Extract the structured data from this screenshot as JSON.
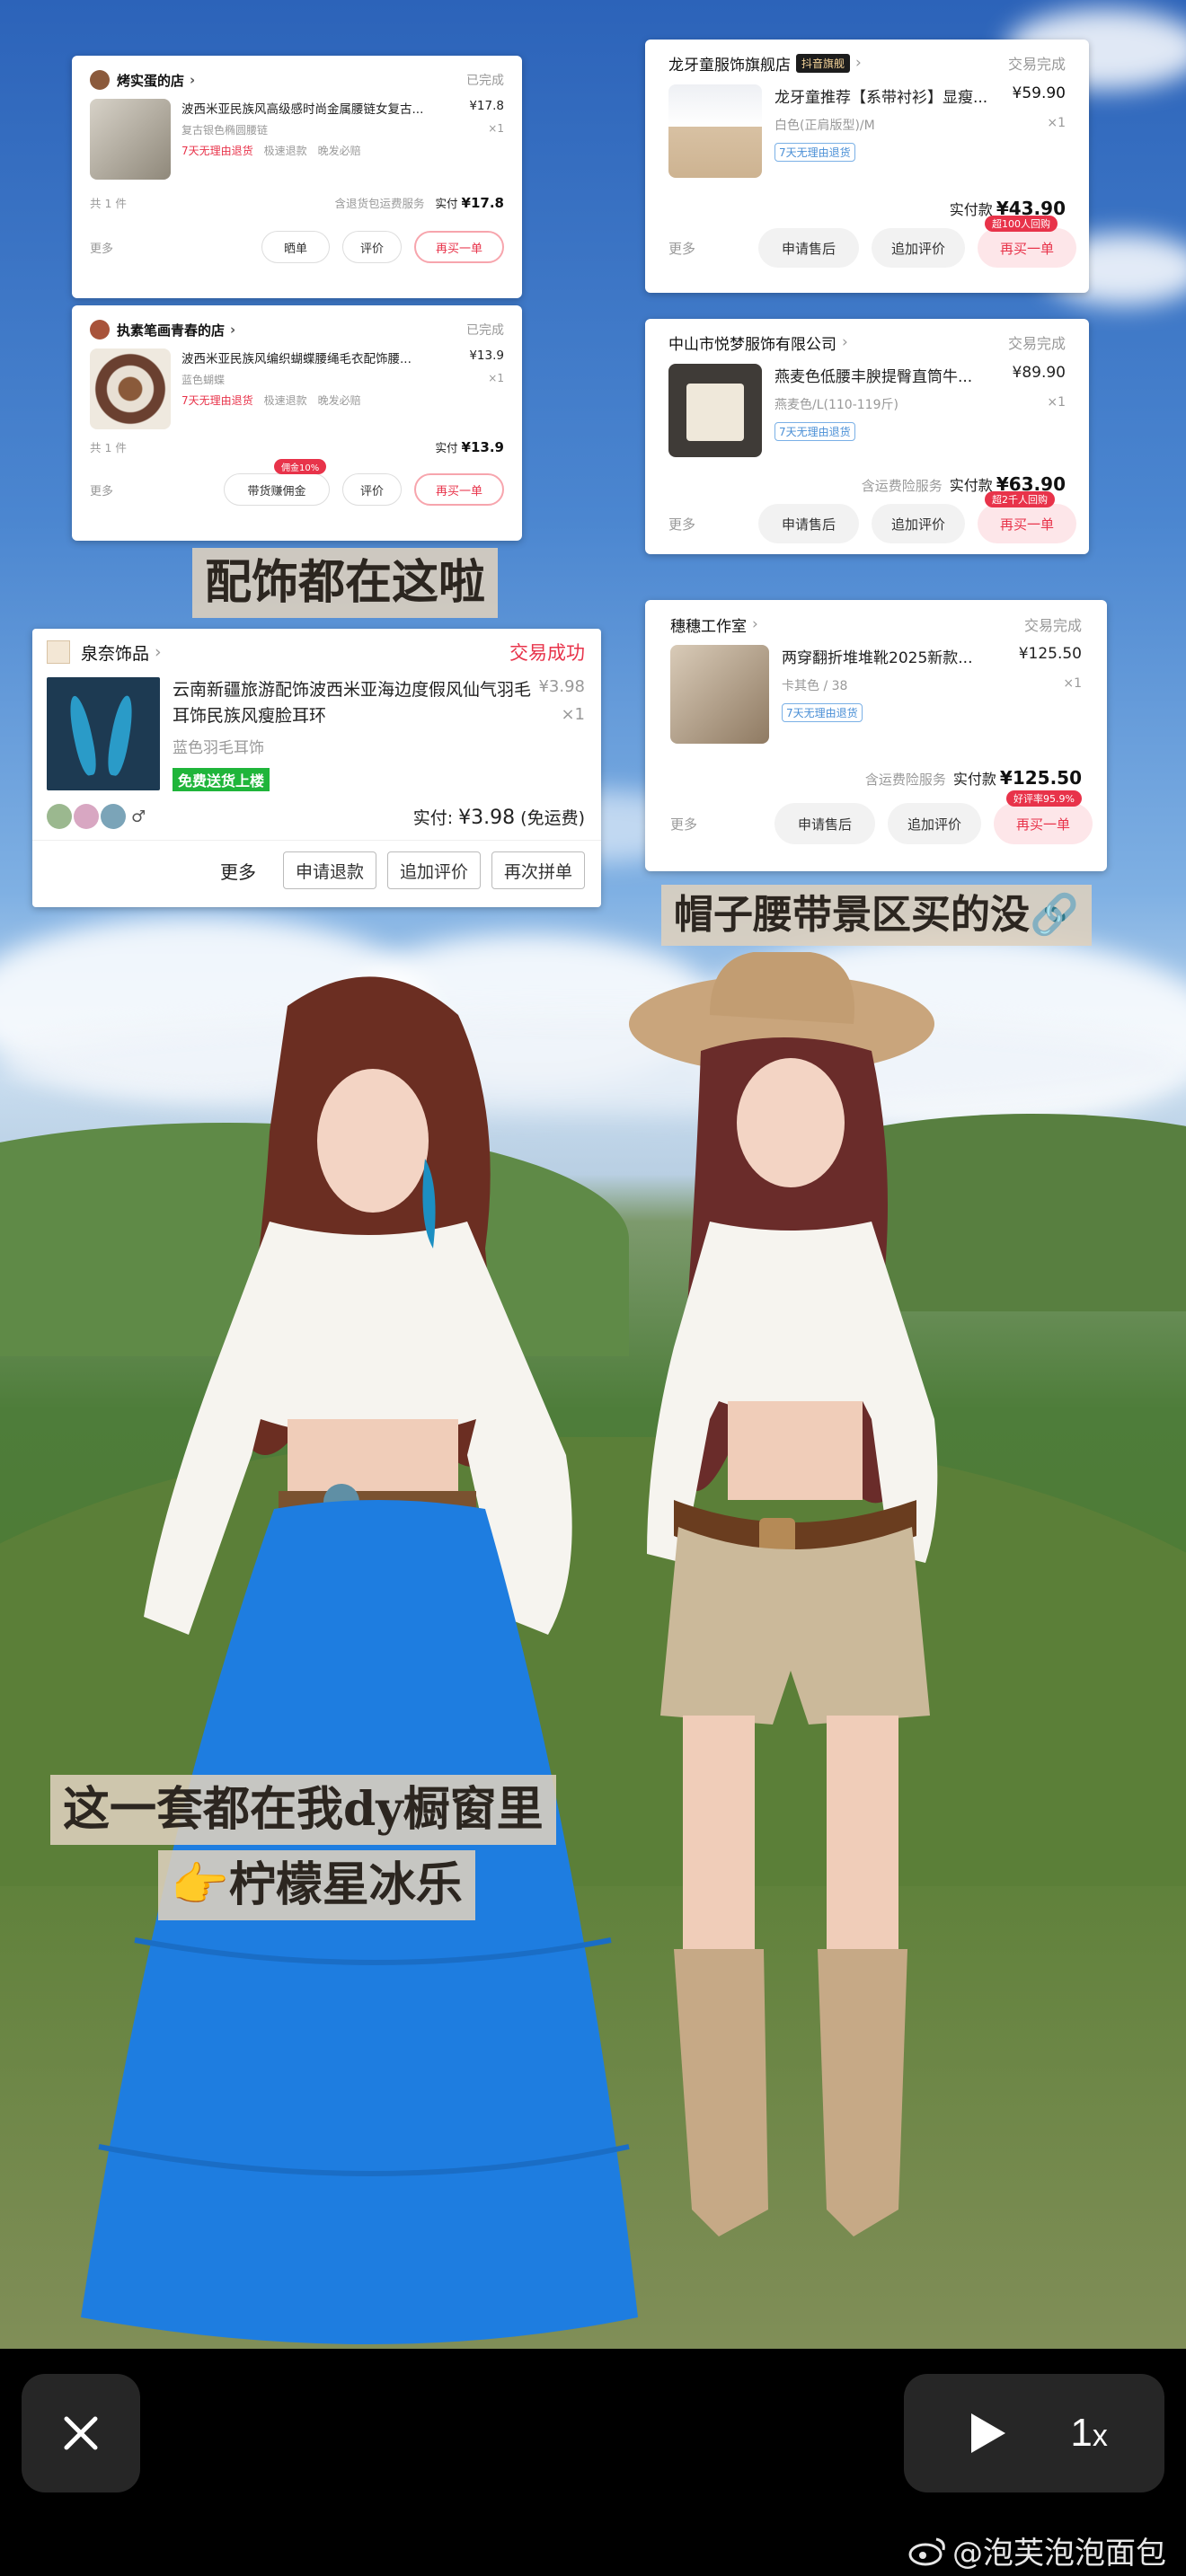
{
  "cards": {
    "c1": {
      "shop": "烤实蛋的店",
      "status": "已完成",
      "title": "波西米亚民族风高级感时尚金属腰链女复古...",
      "price": "¥17.8",
      "spec": "复古银色椭圆腰链",
      "qty": "×1",
      "tag1": "7天无理由退货",
      "tag2": "极速退款",
      "tag3": "晚发必赔",
      "count": "共 1 件",
      "service": "含退货包运费服务",
      "paid_label": "实付",
      "paid": "¥17.8",
      "more": "更多",
      "btn1": "晒单",
      "btn2": "评价",
      "btn3": "再买一单"
    },
    "c2": {
      "shop": "执素笔画青春的店",
      "status": "已完成",
      "title": "波西米亚民族风编织蝴蝶腰绳毛衣配饰腰...",
      "price": "¥13.9",
      "spec": "蓝色蝴蝶",
      "qty": "×1",
      "tag1": "7天无理由退货",
      "tag2": "极速退款",
      "tag3": "晚发必赔",
      "count": "共 1 件",
      "paid_label": "实付",
      "paid": "¥13.9",
      "more": "更多",
      "btn1": "带货赚佣金",
      "btn1_badge": "佣金10%",
      "btn2": "评价",
      "btn3": "再买一单"
    },
    "c3": {
      "shop": "泉奈饰品",
      "status": "交易成功",
      "title": "云南新疆旅游配饰波西米亚海边度假风仙气羽毛耳饰民族风瘦脸耳环",
      "price": "¥3.98",
      "qty": "×1",
      "spec": "蓝色羽毛耳饰",
      "free": "免费送货上楼",
      "paid_label": "实付:",
      "paid": "¥3.98",
      "paid_note": "(免运费)",
      "more": "更多",
      "btn1": "申请退款",
      "btn2": "追加评价",
      "btn3": "再次拼单"
    },
    "c4": {
      "shop": "龙牙童服饰旗舰店",
      "shop_badge": "抖音旗舰",
      "status": "交易完成",
      "title": "龙牙童推荐【系带衬衫】显瘦...",
      "price": "¥59.90",
      "spec": "白色(正肩版型)/M",
      "qty": "×1",
      "tag": "7天无理由退货",
      "paid_label": "实付款",
      "paid": "¥43.90",
      "more": "更多",
      "btn1": "申请售后",
      "btn2": "追加评价",
      "btn3": "再买一单",
      "btn3_badge": "超100人回购"
    },
    "c5": {
      "shop": "中山市悦梦服饰有限公司",
      "status": "交易完成",
      "title": "燕麦色低腰丰腴提臀直筒牛...",
      "price": "¥89.90",
      "spec": "燕麦色/L(110-119斤)",
      "qty": "×1",
      "tag": "7天无理由退货",
      "service": "含运费险服务",
      "paid_label": "实付款",
      "paid": "¥63.90",
      "more": "更多",
      "btn1": "申请售后",
      "btn2": "追加评价",
      "btn3": "再买一单",
      "btn3_badge": "超2千人回购"
    },
    "c6": {
      "shop": "穗穗工作室",
      "status": "交易完成",
      "title": "两穿翻折堆堆靴2025新款...",
      "price": "¥125.50",
      "spec": "卡其色 / 38",
      "qty": "×1",
      "tag": "7天无理由退货",
      "service": "含运费险服务",
      "paid_label": "实付款",
      "paid": "¥125.50",
      "more": "更多",
      "btn1": "申请售后",
      "btn2": "追加评价",
      "btn3": "再买一单",
      "btn3_badge": "好评率95.9%"
    }
  },
  "captions": {
    "accessories": "配饰都在这啦",
    "hat_belt": "帽子腰带景区买的没🔗",
    "window_line1": "这一套都在我dy橱窗里",
    "window_line2": "👉柠檬星冰乐"
  },
  "player": {
    "speed": "1",
    "speed_unit": "x"
  },
  "watermark": "@泡芙泡泡面包",
  "colors": {
    "accent_red": "#e8334a",
    "skirt_blue": "#1e7de0"
  }
}
